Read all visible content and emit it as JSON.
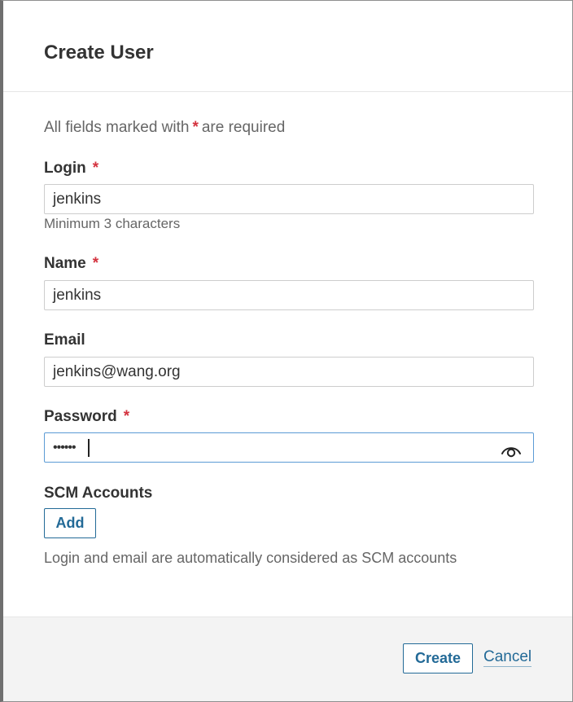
{
  "dialog": {
    "title": "Create User",
    "required_note_prefix": "All fields marked with",
    "required_marker": "*",
    "required_note_suffix": "are required"
  },
  "fields": {
    "login": {
      "label": "Login",
      "required_marker": "*",
      "value": "jenkins",
      "hint": "Minimum 3 characters"
    },
    "name": {
      "label": "Name",
      "required_marker": "*",
      "value": "jenkins"
    },
    "email": {
      "label": "Email",
      "value": "jenkins@wang.org"
    },
    "password": {
      "label": "Password",
      "required_marker": "*",
      "masked_value": "••••••",
      "toggle_icon": "eye-icon"
    }
  },
  "scm": {
    "label": "SCM Accounts",
    "add_label": "Add",
    "note": "Login and email are automatically considered as SCM accounts"
  },
  "footer": {
    "create_label": "Create",
    "cancel_label": "Cancel"
  },
  "colors": {
    "required": "#d4333f",
    "accent": "#236a97",
    "focus_border": "#5b9bd5",
    "footer_bg": "#f3f3f3"
  }
}
